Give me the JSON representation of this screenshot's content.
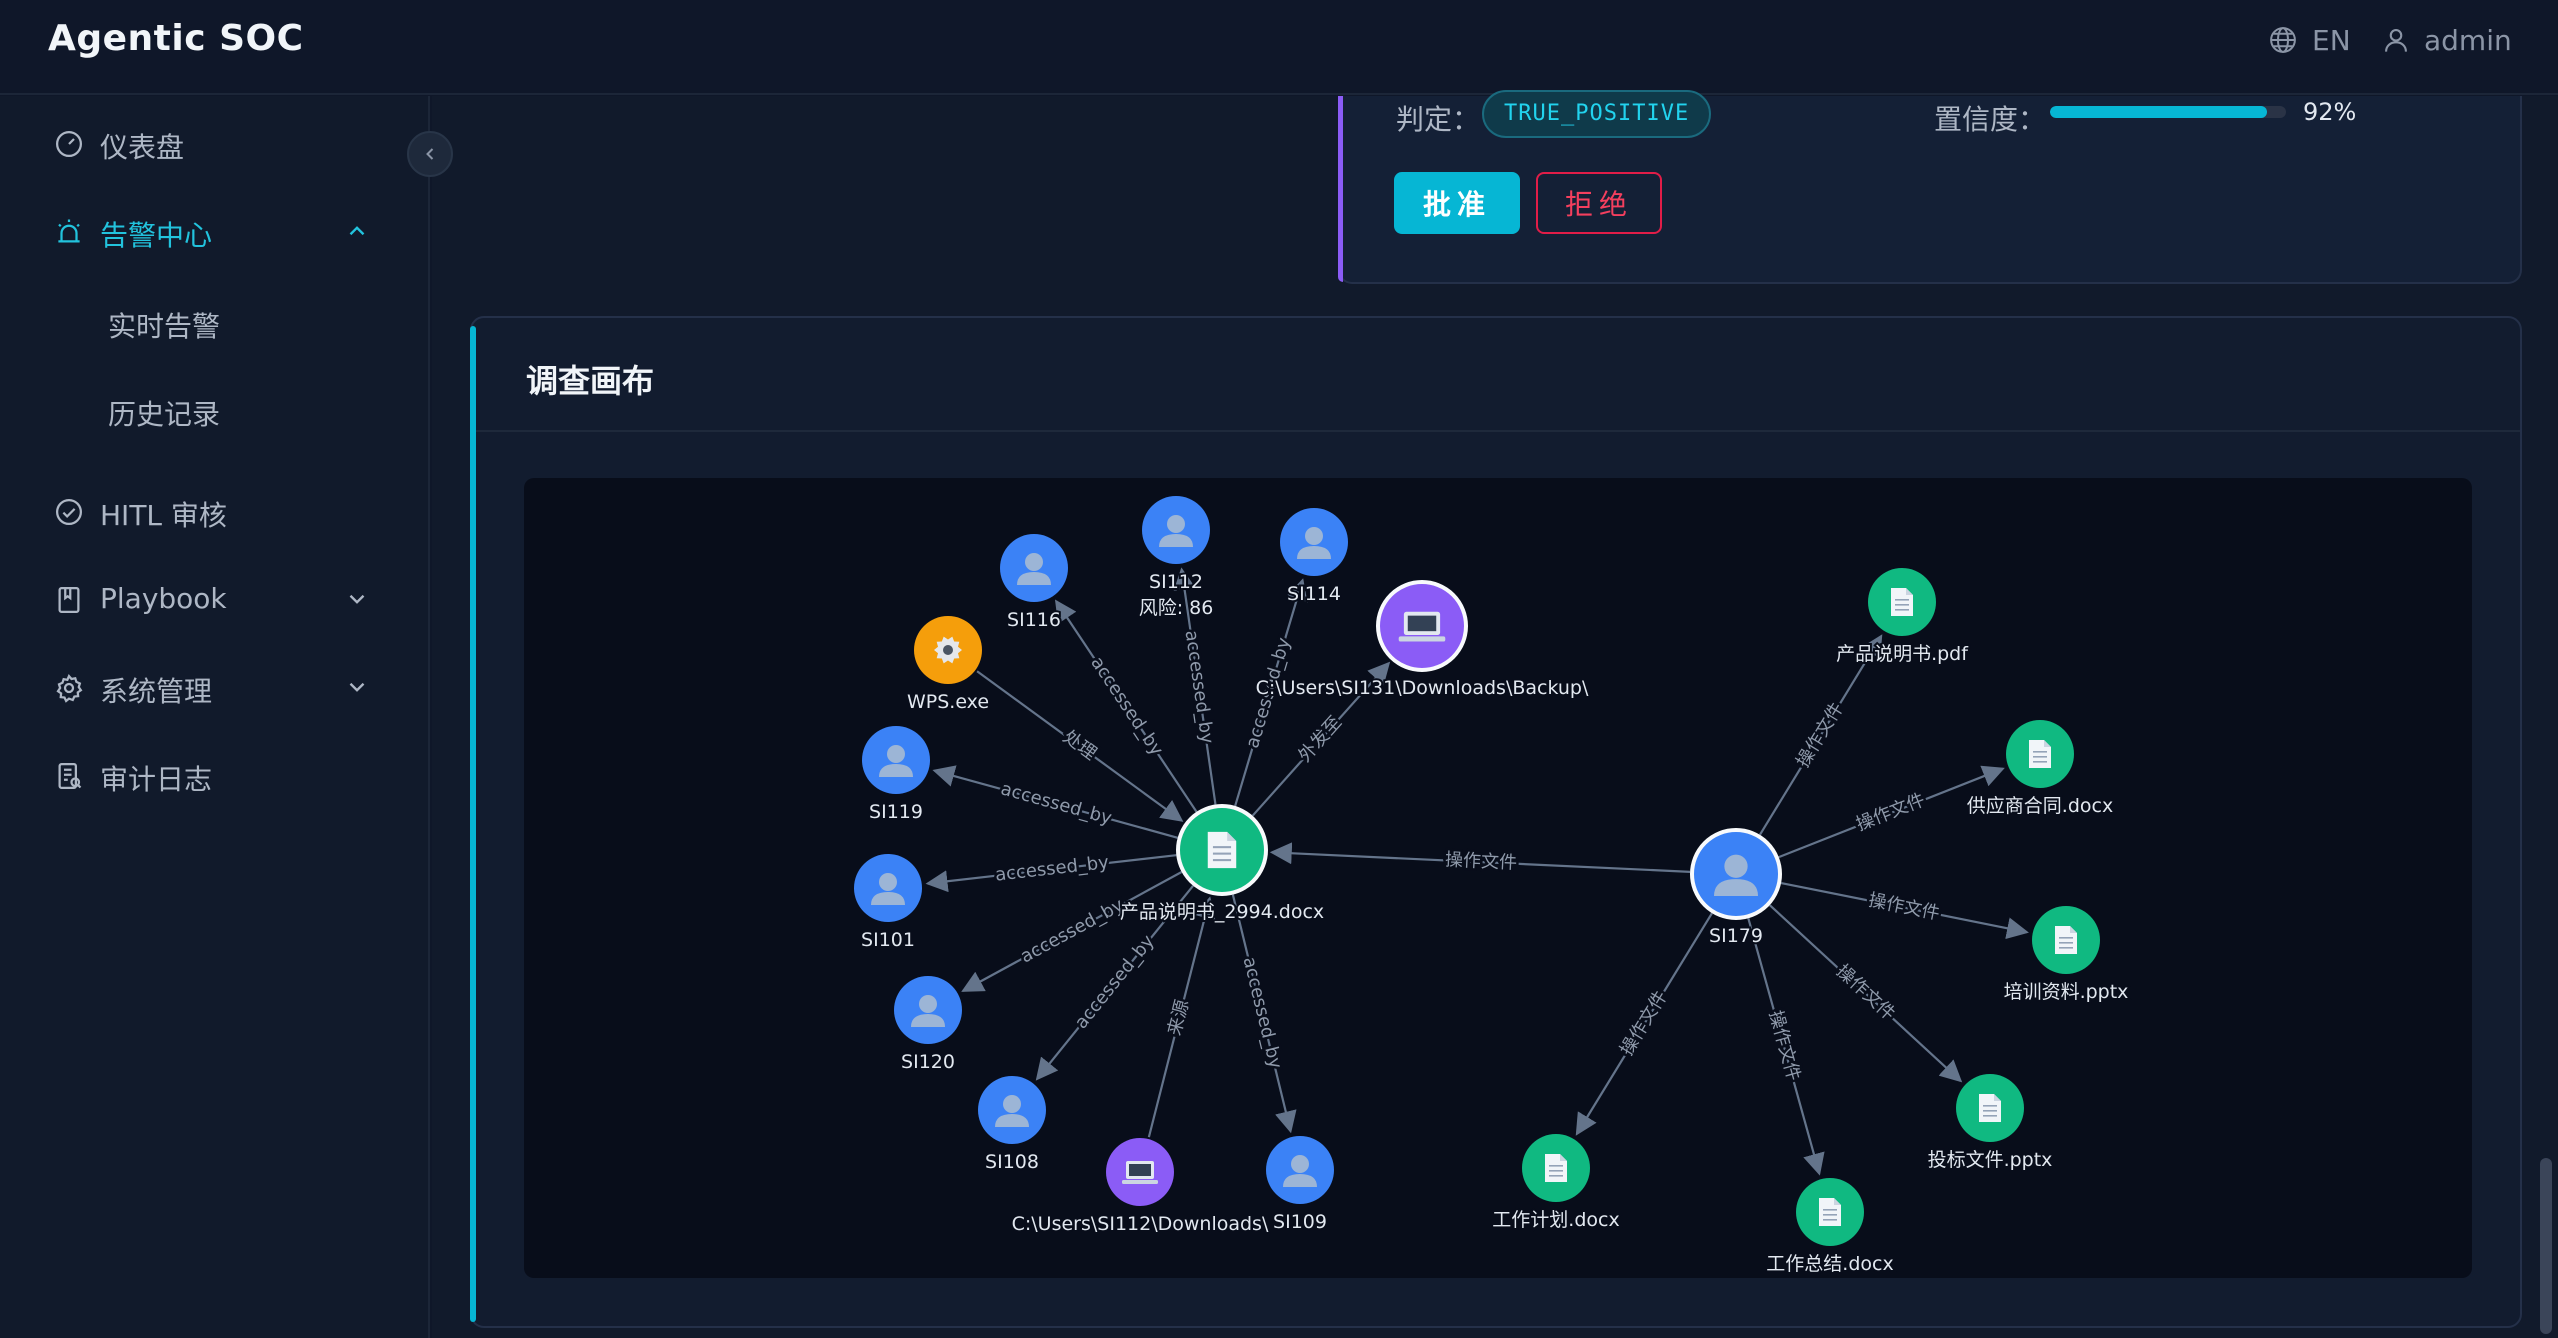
{
  "header": {
    "title": "Agentic SOC",
    "lang": "EN",
    "user": "admin"
  },
  "sidebar": {
    "items": [
      {
        "label": "仪表盘",
        "icon": "dashboard-icon"
      },
      {
        "label": "告警中心",
        "icon": "alarm-icon",
        "active": true,
        "expanded": true,
        "children": [
          {
            "label": "实时告警"
          },
          {
            "label": "历史记录"
          }
        ]
      },
      {
        "label": "HITL 审核",
        "icon": "check-circle-icon"
      },
      {
        "label": "Playbook",
        "icon": "book-icon"
      },
      {
        "label": "系统管理",
        "icon": "gear-icon"
      },
      {
        "label": "审计日志",
        "icon": "audit-log-icon"
      }
    ]
  },
  "verdict": {
    "label": "判定：",
    "value": "TRUE_POSITIVE",
    "confidence_label": "置信度：",
    "confidence": 0.92,
    "confidence_text": "92%",
    "approve": "批准",
    "reject": "拒绝"
  },
  "canvas": {
    "title": "调查画布"
  },
  "colors": {
    "user": "#3b82f6",
    "file": "#10b981",
    "host": "#8b5cf6",
    "process": "#f59e0b",
    "accent": "#06b6d4",
    "edge": "#64748b"
  },
  "graph": {
    "nodes": [
      {
        "id": "doc",
        "label": "产品说明书_2994.docx",
        "type": "file",
        "big": true
      },
      {
        "id": "si179",
        "label": "SI179",
        "type": "user",
        "big": true
      },
      {
        "id": "si112",
        "label": "SI112",
        "sublabel": "风险: 86",
        "type": "user"
      },
      {
        "id": "si114",
        "label": "SI114",
        "type": "user"
      },
      {
        "id": "si116",
        "label": "SI116",
        "type": "user"
      },
      {
        "id": "backup",
        "label": "C:\\Users\\SI131\\Downloads\\Backup\\",
        "type": "host",
        "big": true
      },
      {
        "id": "wps",
        "label": "WPS.exe",
        "type": "process"
      },
      {
        "id": "si119",
        "label": "SI119",
        "type": "user"
      },
      {
        "id": "si101",
        "label": "SI101",
        "type": "user"
      },
      {
        "id": "si120",
        "label": "SI120",
        "type": "user"
      },
      {
        "id": "si108",
        "label": "SI108",
        "type": "user"
      },
      {
        "id": "dl112",
        "label": "C:\\Users\\SI112\\Downloads\\",
        "type": "host"
      },
      {
        "id": "si109",
        "label": "SI109",
        "type": "user"
      },
      {
        "id": "f_pdf",
        "label": "产品说明书.pdf",
        "type": "file"
      },
      {
        "id": "f_supply",
        "label": "供应商合同.docx",
        "type": "file"
      },
      {
        "id": "f_train",
        "label": "培训资料.pptx",
        "type": "file"
      },
      {
        "id": "f_bid",
        "label": "投标文件.pptx",
        "type": "file"
      },
      {
        "id": "f_summary",
        "label": "工作总结.docx",
        "type": "file"
      },
      {
        "id": "f_plan",
        "label": "工作计划.docx",
        "type": "file"
      }
    ],
    "edges": [
      {
        "from": "doc",
        "to": "si112",
        "label": "accessed_by"
      },
      {
        "from": "doc",
        "to": "si114",
        "label": "accessed_by"
      },
      {
        "from": "doc",
        "to": "si116",
        "label": "accessed_by"
      },
      {
        "from": "doc",
        "to": "backup",
        "label": "外发至"
      },
      {
        "from": "wps",
        "to": "doc",
        "label": "处理"
      },
      {
        "from": "doc",
        "to": "si119",
        "label": "accessed_by"
      },
      {
        "from": "doc",
        "to": "si101",
        "label": "accessed_by"
      },
      {
        "from": "doc",
        "to": "si120",
        "label": "accessed_by"
      },
      {
        "from": "doc",
        "to": "si108",
        "label": "accessed_by"
      },
      {
        "from": "dl112",
        "to": "doc",
        "label": "来源"
      },
      {
        "from": "doc",
        "to": "si109",
        "label": "accessed_by"
      },
      {
        "from": "si179",
        "to": "doc",
        "label": "操作文件"
      },
      {
        "from": "si179",
        "to": "f_pdf",
        "label": "操作文件"
      },
      {
        "from": "si179",
        "to": "f_supply",
        "label": "操作文件"
      },
      {
        "from": "si179",
        "to": "f_train",
        "label": "操作文件"
      },
      {
        "from": "si179",
        "to": "f_bid",
        "label": "操作文件"
      },
      {
        "from": "si179",
        "to": "f_summary",
        "label": "操作文件"
      },
      {
        "from": "si179",
        "to": "f_plan",
        "label": "操作文件"
      }
    ]
  }
}
